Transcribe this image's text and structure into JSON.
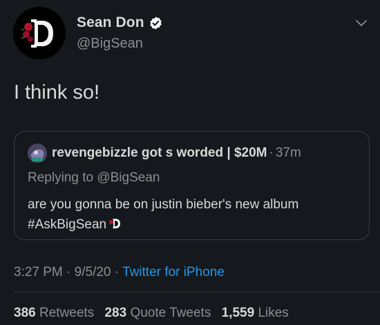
{
  "author": {
    "display_name": "Sean Don",
    "handle": "@BigSean",
    "verified": true
  },
  "tweet": {
    "text": "I think so!"
  },
  "quoted_tweet": {
    "author_name": "revengebizzle got s worded | $20M",
    "separator": "·",
    "time": "37m",
    "replying_to": "Replying to @BigSean",
    "body_line1": "are you gonna be on justin bieber's new album",
    "body_line2": "#AskBigSean"
  },
  "meta": {
    "time": "3:27 PM",
    "sep1": "·",
    "date": "9/5/20",
    "sep2": "·",
    "source": "Twitter for iPhone"
  },
  "stats": {
    "retweets_count": "386",
    "retweets_label": "Retweets",
    "quote_count": "283",
    "quote_label": "Quote Tweets",
    "likes_count": "1,559",
    "likes_label": "Likes"
  },
  "colors": {
    "background": "#15181c",
    "link": "#1d9bf0",
    "secondary_text": "#8b8f93",
    "primary_text": "#d9d9d9"
  },
  "icons": {
    "verified": "verified-badge-icon",
    "chevron": "chevron-down-icon",
    "avatar_logo": "gothic-d-rose-logo"
  }
}
